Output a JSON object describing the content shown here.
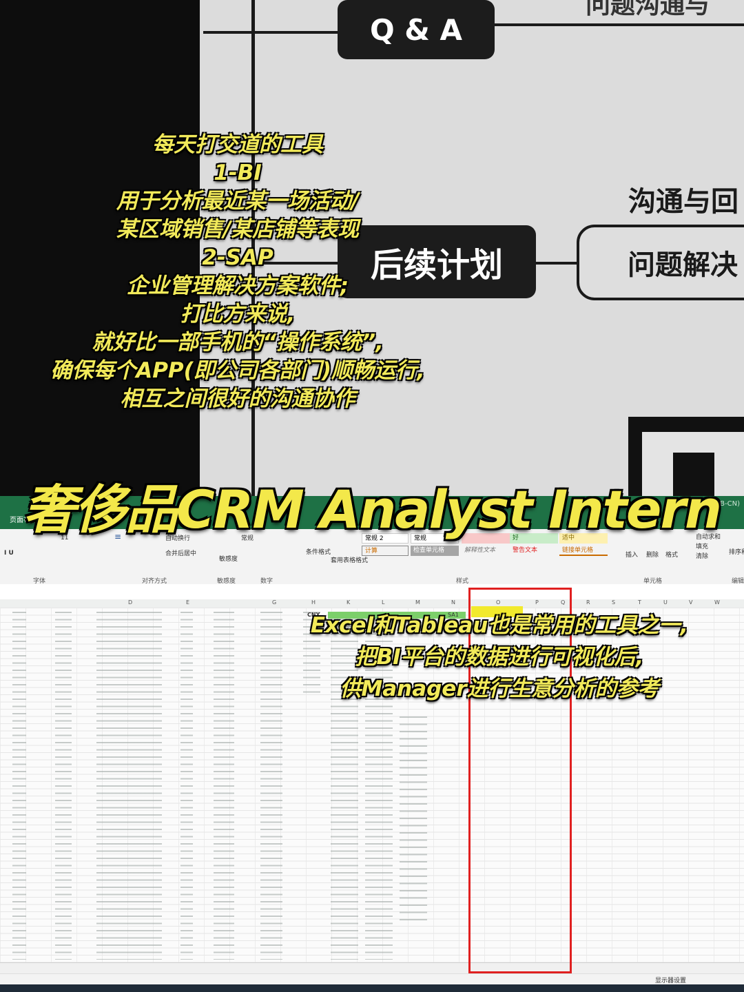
{
  "whiteboard": {
    "qa_label": "Q & A",
    "top_right_text": "问题沟通与",
    "plan_label": "后续计划",
    "comm_label": "沟通与回",
    "problem_label": "问题解决"
  },
  "overlay_top": {
    "lines": [
      "每天打交道的工具",
      "1-BI",
      "用于分析最近某一场活动/",
      "某区域销售/某店铺等表现",
      "2-SAP",
      "企业管理解决方案软件;",
      "打比方来说,",
      "就好比一部手机的“操作系统”,",
      "确保每个APP(即公司各部门)顺畅运行,",
      "相互之间很好的沟通协作"
    ]
  },
  "title": "奢侈品CRM Analyst Intern",
  "excel": {
    "ribbon_tab": "页面布局",
    "titlebar_right": "MTB-CN)",
    "ribbon": {
      "font_size": "11",
      "wrap": "自动换行",
      "merge": "合并后居中",
      "general": "常规",
      "sensitivity": "敏感度",
      "cond_format": "条件格式",
      "table_format": "套用表格格式",
      "style_normal2": "常规 2",
      "style_normal": "常规",
      "style_good": "好",
      "style_neutral": "适中",
      "style_calc": "计算",
      "style_check": "检查单元格",
      "style_explain": "解释性文本",
      "style_warn": "警告文本",
      "style_link": "链接单元格",
      "insert": "插入",
      "delete": "删除",
      "format": "格式",
      "autosum": "自动求和",
      "fill": "填充",
      "clear": "清除",
      "sort": "排序和",
      "groups": {
        "font": "字体",
        "align": "对齐方式",
        "sens": "敏感度",
        "number": "数字",
        "styles": "样式",
        "cells": "单元格",
        "edit": "编辑"
      }
    },
    "columns": [
      "D",
      "E",
      "G",
      "H",
      "K",
      "L",
      "M",
      "N",
      "O",
      "P",
      "Q",
      "R",
      "S",
      "T",
      "U",
      "V",
      "W"
    ],
    "header_cny": "CNY",
    "header_sa": "SA1",
    "status": "显示器设置",
    "accent_green": "#1e7145",
    "highlight_red": "#e02020",
    "highlight_yellow": "#f2ea2c"
  },
  "overlay_excel": {
    "lines": [
      "Excel和Tableau也是常用的工具之一,",
      "把BI平台的数据进行可视化后,",
      "供Manager进行生意分析的参考"
    ]
  }
}
